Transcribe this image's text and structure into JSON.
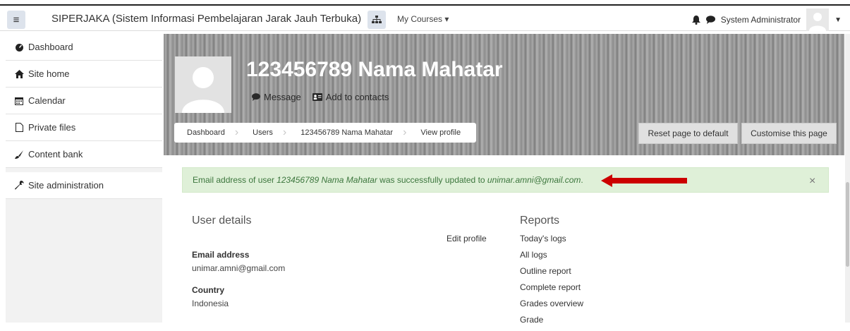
{
  "navbar": {
    "site_name": "SIPERJAKA (Sistem Informasi Pembelajaran Jarak Jauh Terbuka)",
    "my_courses": "My Courses ▾",
    "user_name": "System Administrator"
  },
  "sidebar": {
    "items": [
      {
        "label": "Dashboard",
        "icon": "tachometer-icon"
      },
      {
        "label": "Site home",
        "icon": "home-icon"
      },
      {
        "label": "Calendar",
        "icon": "calendar-icon"
      },
      {
        "label": "Private files",
        "icon": "file-icon"
      },
      {
        "label": "Content bank",
        "icon": "paintbrush-icon"
      },
      {
        "label": "Site administration",
        "icon": "wrench-icon"
      }
    ]
  },
  "profile": {
    "name": "123456789 Nama Mahatar",
    "message_label": "Message",
    "add_contacts_label": "Add to contacts"
  },
  "breadcrumb": [
    "Dashboard",
    "Users",
    "123456789 Nama Mahatar",
    "View profile"
  ],
  "buttons": {
    "reset": "Reset page to default",
    "customise": "Customise this page"
  },
  "alert": {
    "prefix": "Email address of user ",
    "user": "123456789 Nama Mahatar",
    "middle": " was successfully updated to ",
    "email": "unimar.amni@gmail.com",
    "suffix": ".",
    "close": "×",
    "arrow_color": "#cc0000"
  },
  "user_details": {
    "title": "User details",
    "edit_profile": "Edit profile",
    "email_label": "Email address",
    "email_value": "unimar.amni@gmail.com",
    "country_label": "Country",
    "country_value": "Indonesia"
  },
  "reports": {
    "title": "Reports",
    "links": [
      "Today's logs",
      "All logs",
      "Outline report",
      "Complete report",
      "Grades overview",
      "Grade"
    ]
  }
}
